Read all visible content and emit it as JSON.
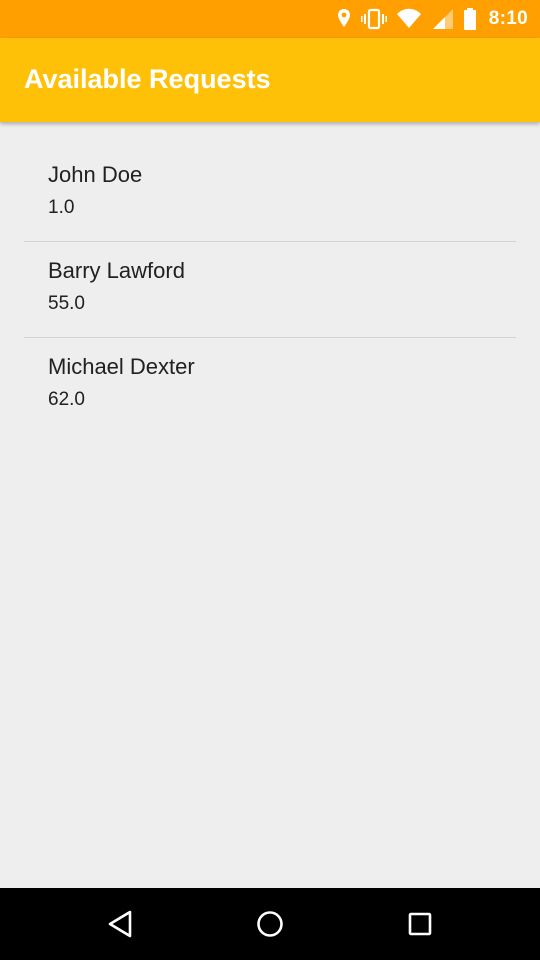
{
  "status_bar": {
    "time": "8:10",
    "icons": [
      "location-icon",
      "vibrate-icon",
      "wifi-icon",
      "signal-icon",
      "battery-icon"
    ]
  },
  "app_bar": {
    "title": "Available Requests"
  },
  "requests": [
    {
      "name": "John Doe",
      "value": "1.0"
    },
    {
      "name": "Barry Lawford",
      "value": "55.0"
    },
    {
      "name": "Michael Dexter",
      "value": "62.0"
    }
  ],
  "nav_bar": {
    "buttons": [
      "back-icon",
      "home-icon",
      "recents-icon"
    ]
  },
  "colors": {
    "status_bar": "#ffa000",
    "app_bar": "#ffc107",
    "background": "#eeeeee"
  }
}
